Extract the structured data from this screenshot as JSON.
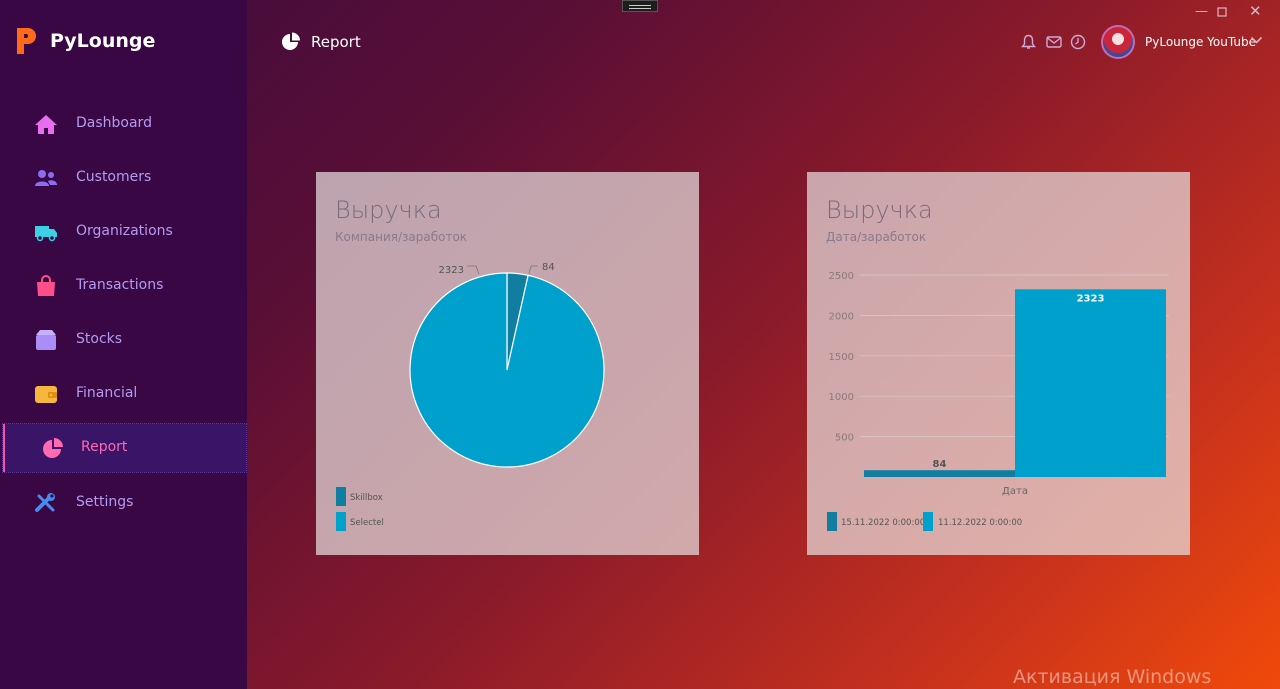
{
  "app": {
    "brand": "PyLounge",
    "page_title": "Report",
    "user_name": "PyLounge YouTube"
  },
  "sidebar": {
    "items": [
      {
        "label": "Dashboard",
        "icon": "home-icon",
        "color": "#e86ef0"
      },
      {
        "label": "Customers",
        "icon": "users-icon",
        "color": "#8a6ef0"
      },
      {
        "label": "Organizations",
        "icon": "truck-icon",
        "color": "#3bd0e6"
      },
      {
        "label": "Transactions",
        "icon": "shopping-bag-icon",
        "color": "#ff4f8a"
      },
      {
        "label": "Stocks",
        "icon": "box-icon",
        "color": "#a98ef5"
      },
      {
        "label": "Financial",
        "icon": "wallet-icon",
        "color": "#f5b83c"
      },
      {
        "label": "Report",
        "icon": "pie-chart-icon",
        "color": "#ff6ab0",
        "active": true
      },
      {
        "label": "Settings",
        "icon": "tools-icon",
        "color": "#4a8af0"
      }
    ]
  },
  "header_icons": [
    "bell-icon",
    "mail-icon",
    "clock-icon"
  ],
  "colors": {
    "accent": "#ff4ea3",
    "series_dark": "#0f7ea0",
    "series_light": "#00a0cc"
  },
  "chart_data": [
    {
      "type": "pie",
      "title": "Выручка",
      "subtitle": "Компания/заработок",
      "labels": [
        "Skillbox",
        "Selectel"
      ],
      "values": [
        84,
        2323
      ],
      "value_labels": [
        "84",
        "2323"
      ]
    },
    {
      "type": "bar",
      "title": "Выручка",
      "subtitle": "Дата/заработок",
      "xlabel": "Дата",
      "ylim": [
        0,
        2500
      ],
      "yticks": [
        "500",
        "1000",
        "1500",
        "2000",
        "2500"
      ],
      "series": [
        {
          "name": "15.11.2022 0:00:00",
          "values": [
            84
          ]
        },
        {
          "name": "11.12.2022 0:00:00",
          "values": [
            2323
          ]
        }
      ]
    }
  ],
  "watermark": "Активация Windows"
}
